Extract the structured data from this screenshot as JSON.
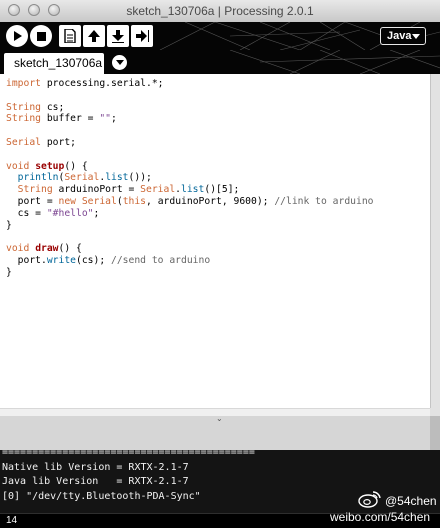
{
  "window": {
    "title": "sketch_130706a | Processing 2.0.1"
  },
  "toolbar": {
    "buttons": [
      {
        "name": "run",
        "icon": "play-icon"
      },
      {
        "name": "stop",
        "icon": "stop-icon"
      },
      {
        "name": "new",
        "icon": "new-file-icon"
      },
      {
        "name": "open",
        "icon": "open-arrow-up-icon"
      },
      {
        "name": "save",
        "icon": "save-arrow-down-icon"
      },
      {
        "name": "export",
        "icon": "export-arrow-right-icon"
      }
    ],
    "mode": "Java"
  },
  "tabs": [
    {
      "label": "sketch_130706a",
      "active": true
    }
  ],
  "editor": {
    "lines": [
      "import processing.serial.*;",
      "",
      "String cs;",
      "String buffer = \"\";",
      "",
      "Serial port;",
      "",
      "void setup() {",
      "  println(Serial.list());",
      "  String arduinoPort = Serial.list()[5];",
      "  port = new Serial(this, arduinoPort, 9600); //link to arduino",
      "  cs = \"#hello\";",
      "}",
      "",
      "void draw() {",
      "  port.write(cs); //send to arduino",
      "}"
    ]
  },
  "console": {
    "lines": [
      "==========================================",
      "Native lib Version = RXTX-2.1-7",
      "Java lib Version   = RXTX-2.1-7",
      "[0] \"/dev/tty.Bluetooth-PDA-Sync\""
    ]
  },
  "status": {
    "line_number": "14"
  },
  "watermark": {
    "handle": "@54chen",
    "url": "weibo.com/54chen"
  },
  "colors": {
    "toolbar_bg": "#050505",
    "keyword": "#cc6633",
    "function": "#006699",
    "string": "#7d4793",
    "comment": "#666666",
    "console_bg": "#141414"
  }
}
